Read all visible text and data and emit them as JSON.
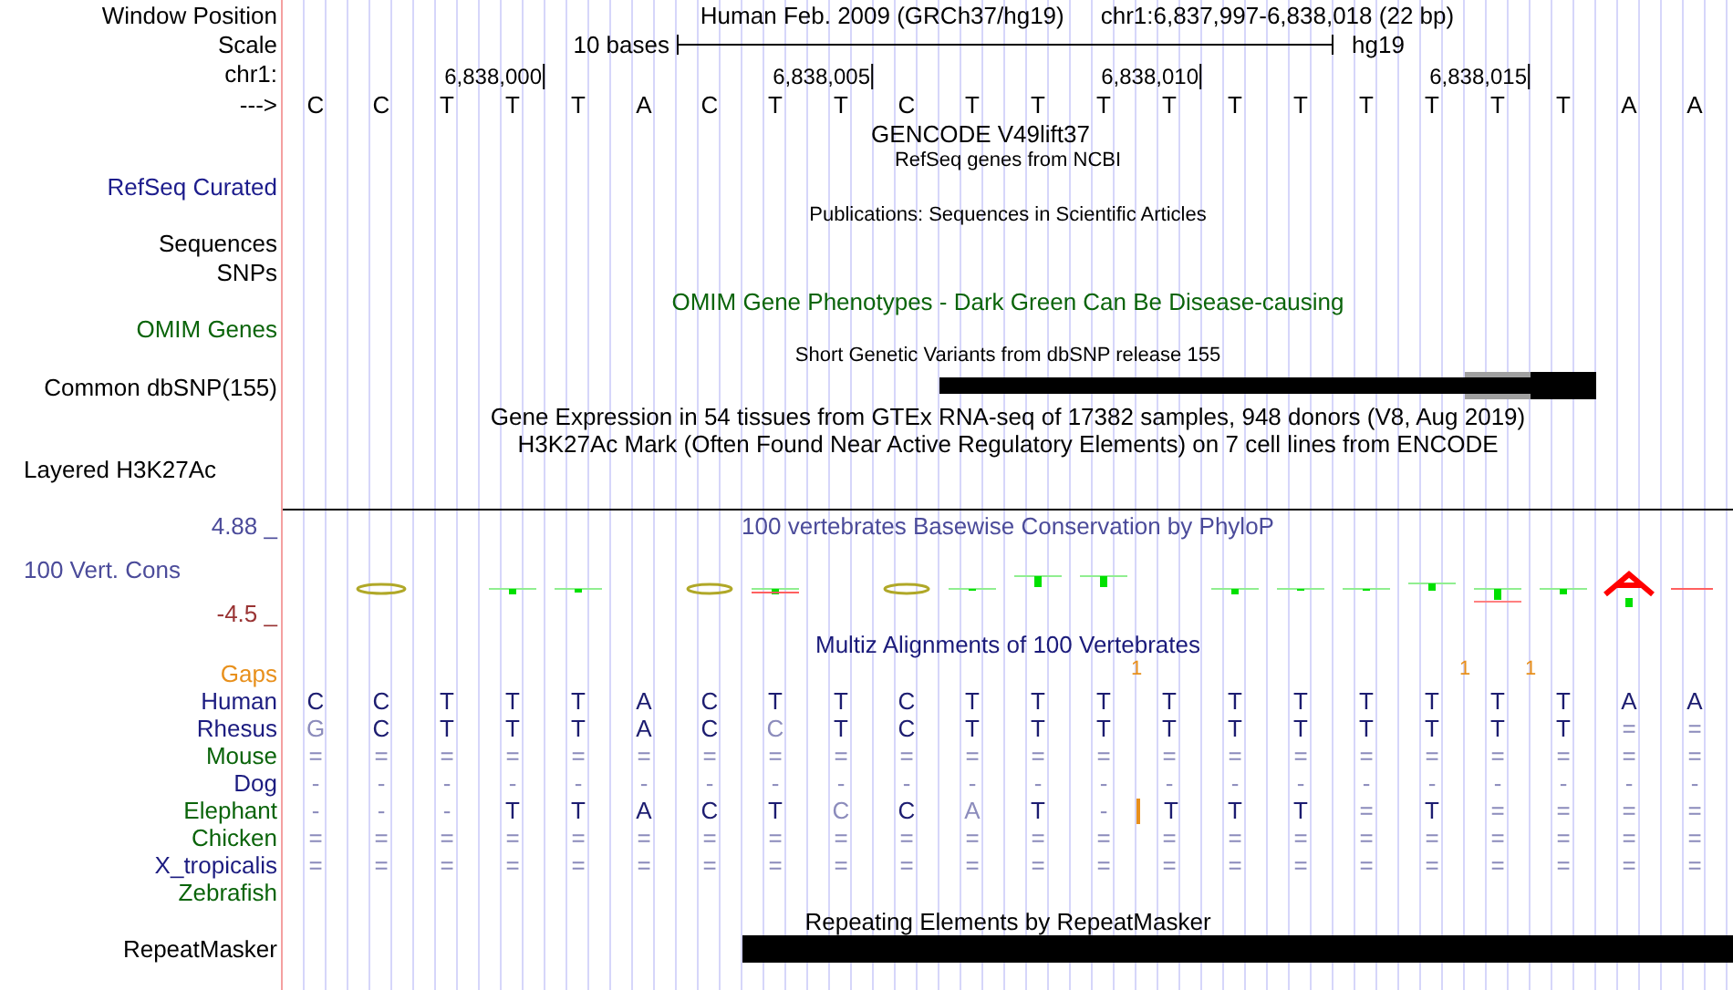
{
  "position": {
    "label": "Window Position",
    "title": "Human Feb. 2009 (GRCh37/hg19)",
    "range": "chr1:6,837,997-6,838,018 (22 bp)"
  },
  "scale": {
    "label": "Scale",
    "length": "10 bases",
    "assembly": "hg19"
  },
  "ruler": {
    "label": "chr1:",
    "ticks": [
      "6,838,000",
      "6,838,005",
      "6,838,010",
      "6,838,015"
    ]
  },
  "sequence": {
    "label": "--->",
    "bases": [
      "C",
      "C",
      "T",
      "T",
      "T",
      "A",
      "C",
      "T",
      "T",
      "C",
      "T",
      "T",
      "T",
      "T",
      "T",
      "T",
      "T",
      "T",
      "T",
      "T",
      "A",
      "A"
    ]
  },
  "gencode": {
    "title": "GENCODE V49lift37"
  },
  "refseq": {
    "title": "RefSeq genes from NCBI",
    "label": "RefSeq Curated"
  },
  "publications": {
    "title": "Publications: Sequences in Scientific Articles"
  },
  "sequences": {
    "label": "Sequences"
  },
  "snps": {
    "label": "SNPs"
  },
  "omim": {
    "title": "OMIM Gene Phenotypes - Dark Green Can Be Disease-causing",
    "label": "OMIM Genes"
  },
  "dbsnp": {
    "title": "Short Genetic Variants from dbSNP release 155",
    "label": "Common dbSNP(155)"
  },
  "gtex": {
    "title": "Gene Expression in 54 tissues from GTEx RNA-seq of 17382 samples, 948 donors (V8, Aug 2019)"
  },
  "h3k27ac": {
    "title": "H3K27Ac Mark (Often Found Near Active Regulatory Elements) on 7 cell lines from ENCODE",
    "label": "Layered H3K27Ac"
  },
  "conservation": {
    "title": "100 vertebrates Basewise Conservation by PhyloP",
    "label": "100 Vert. Cons",
    "max": "4.88 _",
    "min": "-4.5 _"
  },
  "multiz": {
    "title": "Multiz Alignments of 100 Vertebrates",
    "gaps": {
      "label": "Gaps",
      "columns": [
        {
          "insertion": false
        },
        {
          "insertion": false
        },
        {
          "insertion": false
        },
        {
          "insertion": false
        },
        {
          "insertion": false
        },
        {
          "insertion": false
        },
        {
          "insertion": false
        },
        {
          "insertion": false
        },
        {
          "insertion": false
        },
        {
          "insertion": false
        },
        {
          "insertion": false
        },
        {
          "insertion": false
        },
        {
          "insertion": false
        },
        {
          "insertion": true,
          "count": "1"
        },
        {
          "insertion": false
        },
        {
          "insertion": false
        },
        {
          "insertion": false
        },
        {
          "insertion": false
        },
        {
          "insertion": true,
          "count": "1"
        },
        {
          "insertion": true,
          "count": "1"
        },
        {
          "insertion": false
        },
        {
          "insertion": false
        }
      ]
    },
    "species": [
      {
        "name": "Human",
        "color": "#1c1c80",
        "cells": [
          {
            "base": "C",
            "faded": false,
            "insertion": false
          },
          {
            "base": "C",
            "faded": false,
            "insertion": false
          },
          {
            "base": "T",
            "faded": false,
            "insertion": false
          },
          {
            "base": "T",
            "faded": false,
            "insertion": false
          },
          {
            "base": "T",
            "faded": false,
            "insertion": false
          },
          {
            "base": "A",
            "faded": false,
            "insertion": false
          },
          {
            "base": "C",
            "faded": false,
            "insertion": false
          },
          {
            "base": "T",
            "faded": false,
            "insertion": false
          },
          {
            "base": "T",
            "faded": false,
            "insertion": false
          },
          {
            "base": "C",
            "faded": false,
            "insertion": false
          },
          {
            "base": "T",
            "faded": false,
            "insertion": false
          },
          {
            "base": "T",
            "faded": false,
            "insertion": false
          },
          {
            "base": "T",
            "faded": false,
            "insertion": false
          },
          {
            "base": "T",
            "faded": false,
            "insertion": false
          },
          {
            "base": "T",
            "faded": false,
            "insertion": false
          },
          {
            "base": "T",
            "faded": false,
            "insertion": false
          },
          {
            "base": "T",
            "faded": false,
            "insertion": false
          },
          {
            "base": "T",
            "faded": false,
            "insertion": false
          },
          {
            "base": "T",
            "faded": false,
            "insertion": false
          },
          {
            "base": "T",
            "faded": false,
            "insertion": false
          },
          {
            "base": "A",
            "faded": false,
            "insertion": false
          },
          {
            "base": "A",
            "faded": false,
            "insertion": false
          }
        ]
      },
      {
        "name": "Rhesus",
        "color": "#1c1c80",
        "cells": [
          {
            "base": "G",
            "faded": true,
            "insertion": false
          },
          {
            "base": "C",
            "faded": false,
            "insertion": false
          },
          {
            "base": "T",
            "faded": false,
            "insertion": false
          },
          {
            "base": "T",
            "faded": false,
            "insertion": false
          },
          {
            "base": "T",
            "faded": false,
            "insertion": false
          },
          {
            "base": "A",
            "faded": false,
            "insertion": false
          },
          {
            "base": "C",
            "faded": false,
            "insertion": false
          },
          {
            "base": "C",
            "faded": true,
            "insertion": false
          },
          {
            "base": "T",
            "faded": false,
            "insertion": false
          },
          {
            "base": "C",
            "faded": false,
            "insertion": false
          },
          {
            "base": "T",
            "faded": false,
            "insertion": false
          },
          {
            "base": "T",
            "faded": false,
            "insertion": false
          },
          {
            "base": "T",
            "faded": false,
            "insertion": false
          },
          {
            "base": "T",
            "faded": false,
            "insertion": false
          },
          {
            "base": "T",
            "faded": false,
            "insertion": false
          },
          {
            "base": "T",
            "faded": false,
            "insertion": false
          },
          {
            "base": "T",
            "faded": false,
            "insertion": false
          },
          {
            "base": "T",
            "faded": false,
            "insertion": false
          },
          {
            "base": "T",
            "faded": false,
            "insertion": false
          },
          {
            "base": "T",
            "faded": false,
            "insertion": false
          },
          {
            "base": "=",
            "faded": true,
            "insertion": false
          },
          {
            "base": "=",
            "faded": true,
            "insertion": false
          }
        ]
      },
      {
        "name": "Mouse",
        "color": "#0a640a",
        "cells": [
          {
            "base": "=",
            "faded": true,
            "insertion": false
          },
          {
            "base": "=",
            "faded": true,
            "insertion": false
          },
          {
            "base": "=",
            "faded": true,
            "insertion": false
          },
          {
            "base": "=",
            "faded": true,
            "insertion": false
          },
          {
            "base": "=",
            "faded": true,
            "insertion": false
          },
          {
            "base": "=",
            "faded": true,
            "insertion": false
          },
          {
            "base": "=",
            "faded": true,
            "insertion": false
          },
          {
            "base": "=",
            "faded": true,
            "insertion": false
          },
          {
            "base": "=",
            "faded": true,
            "insertion": false
          },
          {
            "base": "=",
            "faded": true,
            "insertion": false
          },
          {
            "base": "=",
            "faded": true,
            "insertion": false
          },
          {
            "base": "=",
            "faded": true,
            "insertion": false
          },
          {
            "base": "=",
            "faded": true,
            "insertion": false
          },
          {
            "base": "=",
            "faded": true,
            "insertion": false
          },
          {
            "base": "=",
            "faded": true,
            "insertion": false
          },
          {
            "base": "=",
            "faded": true,
            "insertion": false
          },
          {
            "base": "=",
            "faded": true,
            "insertion": false
          },
          {
            "base": "=",
            "faded": true,
            "insertion": false
          },
          {
            "base": "=",
            "faded": true,
            "insertion": false
          },
          {
            "base": "=",
            "faded": true,
            "insertion": false
          },
          {
            "base": "=",
            "faded": true,
            "insertion": false
          },
          {
            "base": "=",
            "faded": true,
            "insertion": false
          }
        ]
      },
      {
        "name": "Dog",
        "color": "#1c1c80",
        "cells": [
          {
            "base": "-",
            "faded": true,
            "insertion": false
          },
          {
            "base": "-",
            "faded": true,
            "insertion": false
          },
          {
            "base": "-",
            "faded": true,
            "insertion": false
          },
          {
            "base": "-",
            "faded": true,
            "insertion": false
          },
          {
            "base": "-",
            "faded": true,
            "insertion": false
          },
          {
            "base": "-",
            "faded": true,
            "insertion": false
          },
          {
            "base": "-",
            "faded": true,
            "insertion": false
          },
          {
            "base": "-",
            "faded": true,
            "insertion": false
          },
          {
            "base": "-",
            "faded": true,
            "insertion": false
          },
          {
            "base": "-",
            "faded": true,
            "insertion": false
          },
          {
            "base": "-",
            "faded": true,
            "insertion": false
          },
          {
            "base": "-",
            "faded": true,
            "insertion": false
          },
          {
            "base": "-",
            "faded": true,
            "insertion": false
          },
          {
            "base": "-",
            "faded": true,
            "insertion": false
          },
          {
            "base": "-",
            "faded": true,
            "insertion": false
          },
          {
            "base": "-",
            "faded": true,
            "insertion": false
          },
          {
            "base": "-",
            "faded": true,
            "insertion": false
          },
          {
            "base": "-",
            "faded": true,
            "insertion": false
          },
          {
            "base": "-",
            "faded": true,
            "insertion": false
          },
          {
            "base": "-",
            "faded": true,
            "insertion": false
          },
          {
            "base": "-",
            "faded": true,
            "insertion": false
          },
          {
            "base": "-",
            "faded": true,
            "insertion": false
          }
        ]
      },
      {
        "name": "Elephant",
        "color": "#0a640a",
        "cells": [
          {
            "base": "-",
            "faded": true,
            "insertion": false
          },
          {
            "base": "-",
            "faded": true,
            "insertion": false
          },
          {
            "base": "-",
            "faded": true,
            "insertion": false
          },
          {
            "base": "T",
            "faded": false,
            "insertion": false
          },
          {
            "base": "T",
            "faded": false,
            "insertion": false
          },
          {
            "base": "A",
            "faded": false,
            "insertion": false
          },
          {
            "base": "C",
            "faded": false,
            "insertion": false
          },
          {
            "base": "T",
            "faded": false,
            "insertion": false
          },
          {
            "base": "C",
            "faded": true,
            "insertion": false
          },
          {
            "base": "C",
            "faded": false,
            "insertion": false
          },
          {
            "base": "A",
            "faded": true,
            "insertion": false
          },
          {
            "base": "T",
            "faded": false,
            "insertion": false
          },
          {
            "base": "-",
            "faded": true,
            "insertion": false
          },
          {
            "base": "T",
            "faded": false,
            "insertion": true
          },
          {
            "base": "T",
            "faded": false,
            "insertion": false
          },
          {
            "base": "T",
            "faded": false,
            "insertion": false
          },
          {
            "base": "=",
            "faded": true,
            "insertion": false
          },
          {
            "base": "T",
            "faded": false,
            "insertion": false
          },
          {
            "base": "=",
            "faded": true,
            "insertion": false
          },
          {
            "base": "=",
            "faded": true,
            "insertion": false
          },
          {
            "base": "=",
            "faded": true,
            "insertion": false
          },
          {
            "base": "=",
            "faded": true,
            "insertion": false
          }
        ]
      },
      {
        "name": "Chicken",
        "color": "#0a640a",
        "cells": [
          {
            "base": "=",
            "faded": true,
            "insertion": false
          },
          {
            "base": "=",
            "faded": true,
            "insertion": false
          },
          {
            "base": "=",
            "faded": true,
            "insertion": false
          },
          {
            "base": "=",
            "faded": true,
            "insertion": false
          },
          {
            "base": "=",
            "faded": true,
            "insertion": false
          },
          {
            "base": "=",
            "faded": true,
            "insertion": false
          },
          {
            "base": "=",
            "faded": true,
            "insertion": false
          },
          {
            "base": "=",
            "faded": true,
            "insertion": false
          },
          {
            "base": "=",
            "faded": true,
            "insertion": false
          },
          {
            "base": "=",
            "faded": true,
            "insertion": false
          },
          {
            "base": "=",
            "faded": true,
            "insertion": false
          },
          {
            "base": "=",
            "faded": true,
            "insertion": false
          },
          {
            "base": "=",
            "faded": true,
            "insertion": false
          },
          {
            "base": "=",
            "faded": true,
            "insertion": false
          },
          {
            "base": "=",
            "faded": true,
            "insertion": false
          },
          {
            "base": "=",
            "faded": true,
            "insertion": false
          },
          {
            "base": "=",
            "faded": true,
            "insertion": false
          },
          {
            "base": "=",
            "faded": true,
            "insertion": false
          },
          {
            "base": "=",
            "faded": true,
            "insertion": false
          },
          {
            "base": "=",
            "faded": true,
            "insertion": false
          },
          {
            "base": "=",
            "faded": true,
            "insertion": false
          },
          {
            "base": "=",
            "faded": true,
            "insertion": false
          }
        ]
      },
      {
        "name": "X_tropicalis",
        "color": "#1c1c80",
        "cells": [
          {
            "base": "=",
            "faded": true,
            "insertion": false
          },
          {
            "base": "=",
            "faded": true,
            "insertion": false
          },
          {
            "base": "=",
            "faded": true,
            "insertion": false
          },
          {
            "base": "=",
            "faded": true,
            "insertion": false
          },
          {
            "base": "=",
            "faded": true,
            "insertion": false
          },
          {
            "base": "=",
            "faded": true,
            "insertion": false
          },
          {
            "base": "=",
            "faded": true,
            "insertion": false
          },
          {
            "base": "=",
            "faded": true,
            "insertion": false
          },
          {
            "base": "=",
            "faded": true,
            "insertion": false
          },
          {
            "base": "=",
            "faded": true,
            "insertion": false
          },
          {
            "base": "=",
            "faded": true,
            "insertion": false
          },
          {
            "base": "=",
            "faded": true,
            "insertion": false
          },
          {
            "base": "=",
            "faded": true,
            "insertion": false
          },
          {
            "base": "=",
            "faded": true,
            "insertion": false
          },
          {
            "base": "=",
            "faded": true,
            "insertion": false
          },
          {
            "base": "=",
            "faded": true,
            "insertion": false
          },
          {
            "base": "=",
            "faded": true,
            "insertion": false
          },
          {
            "base": "=",
            "faded": true,
            "insertion": false
          },
          {
            "base": "=",
            "faded": true,
            "insertion": false
          },
          {
            "base": "=",
            "faded": true,
            "insertion": false
          },
          {
            "base": "=",
            "faded": true,
            "insertion": false
          },
          {
            "base": "=",
            "faded": true,
            "insertion": false
          }
        ]
      },
      {
        "name": "Zebrafish",
        "color": "#0a640a"
      }
    ]
  },
  "repeatmasker": {
    "title": "Repeating Elements by RepeatMasker",
    "label": "RepeatMasker"
  }
}
